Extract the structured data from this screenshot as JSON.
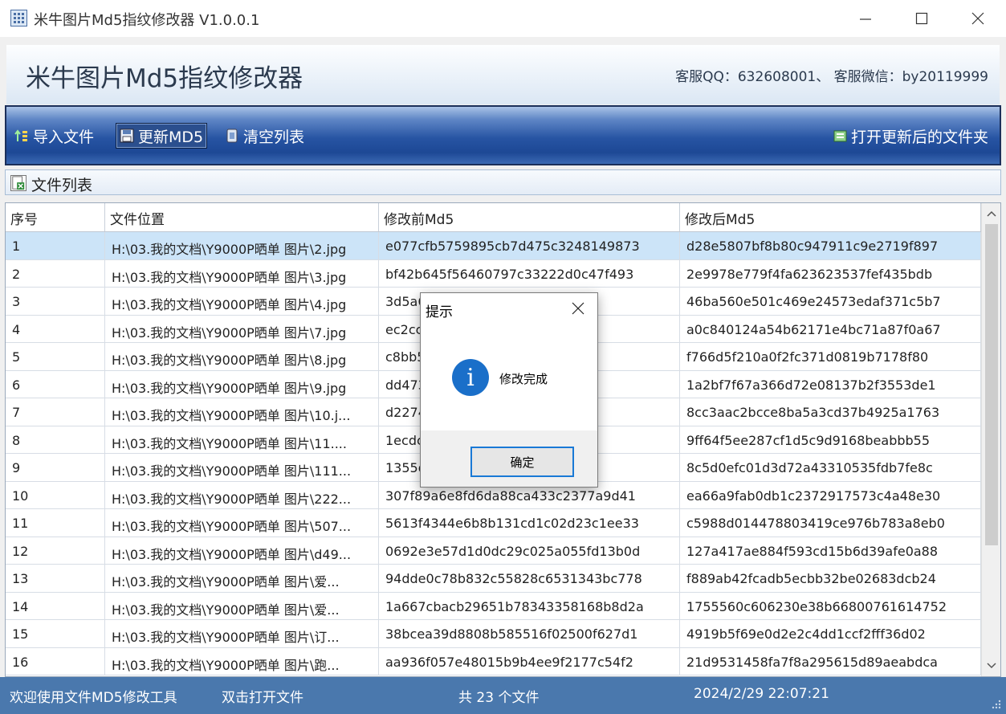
{
  "window": {
    "title": "米牛图片Md5指纹修改器 V1.0.0.1"
  },
  "header": {
    "brand": "米牛图片Md5指纹修改器",
    "contact": "客服QQ：632608001、  客服微信：by20119999"
  },
  "toolbar": {
    "import_label": "导入文件",
    "update_label": "更新MD5",
    "clear_label": "清空列表",
    "open_folder_label": "打开更新后的文件夹"
  },
  "list_section": {
    "label": "文件列表"
  },
  "table": {
    "headers": [
      "序号",
      "文件位置",
      "修改前Md5",
      "修改后Md5"
    ],
    "rows": [
      {
        "no": "1",
        "path": "H:\\03.我的文档\\Y9000P晒单 图片\\2.jpg",
        "before": "e077cfb5759895cb7d475c3248149873",
        "after": "d28e5807bf8b80c947911c9e2719f897"
      },
      {
        "no": "2",
        "path": "H:\\03.我的文档\\Y9000P晒单 图片\\3.jpg",
        "before": "bf42b645f56460797c33222d0c47f493",
        "after": "2e9978e779f4fa623623537fef435bdb"
      },
      {
        "no": "3",
        "path": "H:\\03.我的文档\\Y9000P晒单 图片\\4.jpg",
        "before": "3d5a6                                9cd",
        "after": "46ba560e501c469e24573edaf371c5b7"
      },
      {
        "no": "4",
        "path": "H:\\03.我的文档\\Y9000P晒单 图片\\7.jpg",
        "before": "ec2cc                                0e",
        "after": "a0c840124a54b62171e4bc71a87f0a67"
      },
      {
        "no": "5",
        "path": "H:\\03.我的文档\\Y9000P晒单 图片\\8.jpg",
        "before": "c8bb5                                78",
        "after": "f766d5f210a0f2fc371d0819b7178f80"
      },
      {
        "no": "6",
        "path": "H:\\03.我的文档\\Y9000P晒单 图片\\9.jpg",
        "before": "dd473                                ed4",
        "after": "1a2bf7f67a366d72e08137b2f3553de1"
      },
      {
        "no": "7",
        "path": "H:\\03.我的文档\\Y9000P晒单 图片\\10.j...",
        "before": "d2274                                425",
        "after": "8cc3aac2bcce8ba5a3cd37b4925a1763"
      },
      {
        "no": "8",
        "path": "H:\\03.我的文档\\Y9000P晒单 图片\\11....",
        "before": "1ecdc                                bbc",
        "after": "9ff64f5ee287cf1d5c9d9168beabbb55"
      },
      {
        "no": "9",
        "path": "H:\\03.我的文档\\Y9000P晒单 图片\\111...",
        "before": "1355d                                9cf",
        "after": "8c5d0efc01d3d72a43310535fdb7fe8c"
      },
      {
        "no": "10",
        "path": "H:\\03.我的文档\\Y9000P晒单 图片\\222...",
        "before": "307f89a6e8fd6da88ca433c2377a9d41",
        "after": "ea66a9fab0db1c2372917573c4a48e30"
      },
      {
        "no": "11",
        "path": "H:\\03.我的文档\\Y9000P晒单 图片\\507...",
        "before": "5613f4344e6b8b131cd1c02d23c1ee33",
        "after": "c5988d014478803419ce976b783a8eb0"
      },
      {
        "no": "12",
        "path": "H:\\03.我的文档\\Y9000P晒单 图片\\d49...",
        "before": "0692e3e57d1d0dc29c025a055fd13b0d",
        "after": "127a417ae884f593cd15b6d39afe0a88"
      },
      {
        "no": "13",
        "path": "H:\\03.我的文档\\Y9000P晒单 图片\\爱...",
        "before": "94dde0c78b832c55828c6531343bc778",
        "after": "f889ab42fcadb5ecbb32be02683dcb24"
      },
      {
        "no": "14",
        "path": "H:\\03.我的文档\\Y9000P晒单 图片\\爱...",
        "before": "1a667cbacb29651b78343358168b8d2a",
        "after": "1755560c606230e38b66800761614752"
      },
      {
        "no": "15",
        "path": "H:\\03.我的文档\\Y9000P晒单 图片\\订...",
        "before": "38bcea39d8808b585516f02500f627d1",
        "after": "4919b5f69e0d2e2c4dd1ccf2fff36d02"
      },
      {
        "no": "16",
        "path": "H:\\03.我的文档\\Y9000P晒单 图片\\跑...",
        "before": "aa936f057e48015b9b4ee9f2177c54f2",
        "after": "21d9531458fa7f8a295615d89aeabdca"
      }
    ]
  },
  "status": {
    "welcome": "欢迎使用文件MD5修改工具",
    "hint": "双击打开文件",
    "count": "共 23 个文件",
    "datetime": "2024/2/29 22:07:21"
  },
  "dialog": {
    "title": "提示",
    "message": "修改完成",
    "ok_label": "确定",
    "icon": "info-icon"
  },
  "colors": {
    "toolbar": "#2754a3",
    "status_bar": "#4a78ad",
    "selected_row": "#cce4f8",
    "info_icon": "#1a6fc9"
  }
}
